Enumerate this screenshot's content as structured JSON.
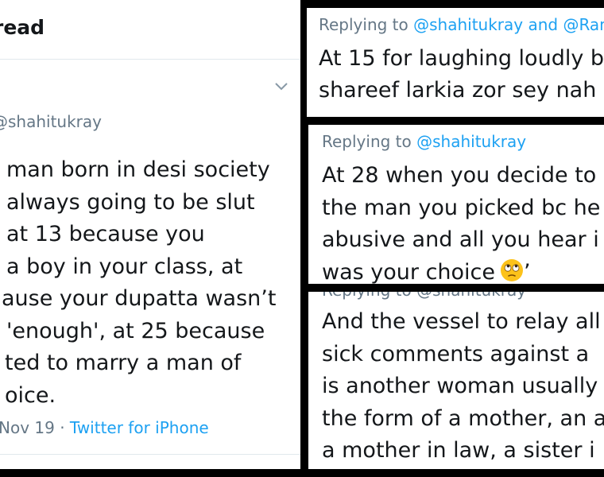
{
  "left_panel": {
    "header_title": "read",
    "handle": "shahitukray",
    "tweet_lines": [
      "man born in desi society",
      "always going to be slut",
      "at 13 because you",
      "a boy in your class, at",
      "ause your dupatta wasn’t",
      "'enough', at 25 because",
      "ted to marry a man of",
      "oice."
    ],
    "meta": {
      "date": "Nov 19",
      "separator": " · ",
      "source": "Twitter for iPhone"
    }
  },
  "reply_top": {
    "replying_prefix": "Replying to ",
    "mention_1": "@shahitukray",
    "conjunction": " and ",
    "mention_2": "@RanjA",
    "lines": [
      "At 15 for laughing loudly b",
      "shareef larkia zor sey nah"
    ]
  },
  "reply_mid": {
    "replying_prefix": "Replying to ",
    "mention": "@shahitukray",
    "lines": [
      "At 28 when you decide to",
      "the man you picked bc he",
      "abusive and all you hear i",
      "was your choice"
    ],
    "trailing_quote": "’",
    "emoji": "face-with-rolling-eyes"
  },
  "reply_bot": {
    "lines": [
      "And the vessel to relay all",
      "sick comments against a",
      "is another woman usually",
      "the form of a mother, an a",
      "a mother in law, a sister i"
    ]
  },
  "colors": {
    "link": "#1da1f2",
    "secondary": "#657786",
    "text": "#14171a",
    "background_gap": "#000000"
  }
}
